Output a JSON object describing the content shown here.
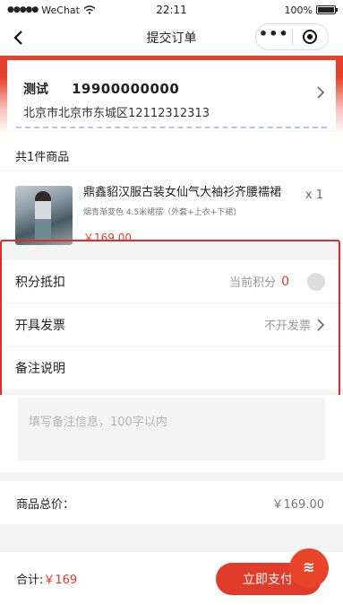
{
  "status_bar": {
    "carrier": "WeChat",
    "time": "22:11",
    "battery": "100%",
    "battery_level": 1.0,
    "signal_dots": "●●●●●",
    "wifi_icon": "wifi-icon"
  },
  "nav": {
    "title": "提交订单",
    "back_icon": "chevron-left-icon",
    "more_icon": "more-dots-icon",
    "target_icon": "target-icon"
  },
  "address": {
    "name": "测试",
    "phone": "19900000000",
    "detail": "北京市北京市东城区12112312313"
  },
  "goods": {
    "count_label": "共1件商品",
    "items": [
      {
        "name": "鼎鑫貂汉服古装女仙气大袖衫齐腰襦裙",
        "spec": "烟青渐变色 4.5米裙摆（外套+上衣+下裙）",
        "price": "￥169.00",
        "qty": "x 1"
      }
    ]
  },
  "options": {
    "points_label": "积分抵扣",
    "points_hint": "当前积分",
    "points_value": "0",
    "points_enabled": false,
    "invoice_label": "开具发票",
    "invoice_value": "不开发票",
    "remark_label": "备注说明",
    "remark_placeholder": "填写备注信息，100字以内",
    "remark_value": ""
  },
  "totals": {
    "goods_total_label": "商品总价：",
    "goods_total_value": "￥169.00"
  },
  "bottom": {
    "sum_label": "合计:",
    "sum_amount": "￥169",
    "pay_label": "立即支付"
  },
  "colors": {
    "accent": "#e13b2b",
    "highlight_border": "#e12b2b"
  }
}
